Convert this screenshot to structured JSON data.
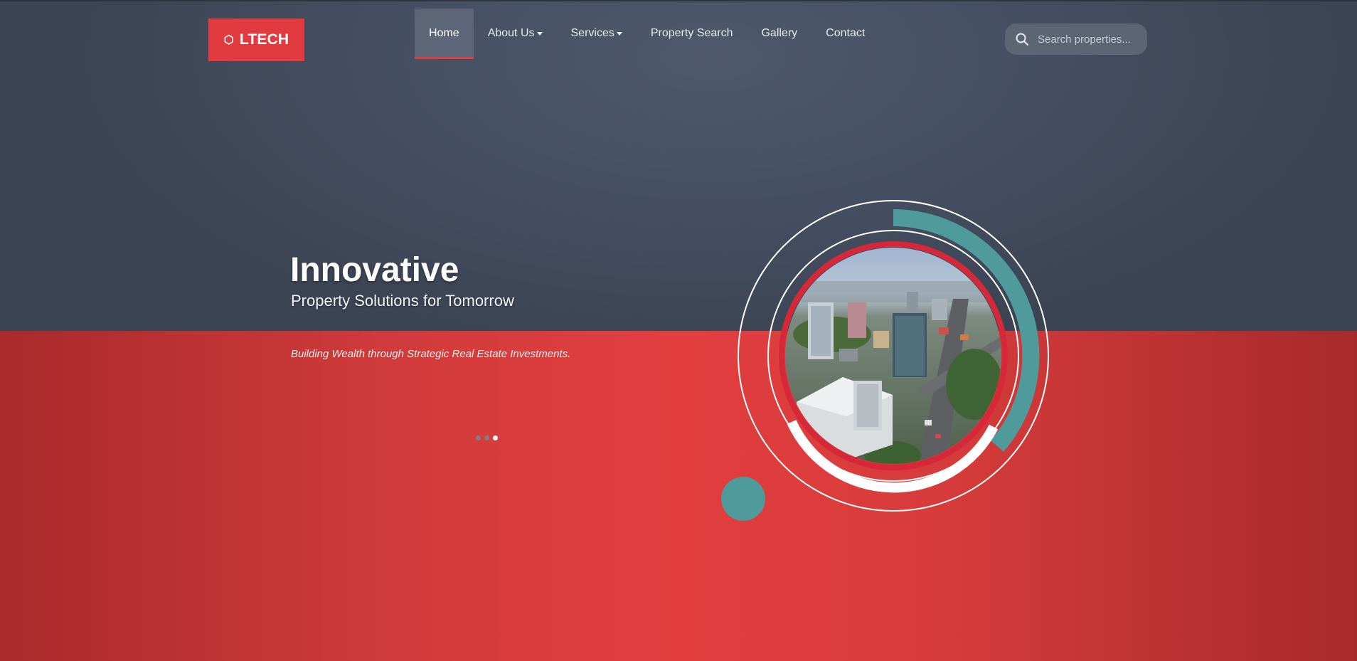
{
  "brand": {
    "logo_icon": "hexagon-icon",
    "logo_text": "LTECH",
    "accent_color": "#e23b3f",
    "teal_color": "#4f9a9a"
  },
  "nav": {
    "items": [
      {
        "label": "Home",
        "active": true,
        "dropdown": false
      },
      {
        "label": "About Us",
        "active": false,
        "dropdown": true
      },
      {
        "label": "Services",
        "active": false,
        "dropdown": true
      },
      {
        "label": "Property Search",
        "active": false,
        "dropdown": false
      },
      {
        "label": "Gallery",
        "active": false,
        "dropdown": false
      },
      {
        "label": "Contact",
        "active": false,
        "dropdown": false
      }
    ]
  },
  "search": {
    "icon": "search-icon",
    "placeholder": "Search properties...",
    "value": ""
  },
  "hero": {
    "title": "Innovative",
    "subtitle": "Property Solutions for Tomorrow",
    "tagline": "Building Wealth through Strategic Real Estate Investments.",
    "slides_count": 3,
    "active_slide": 3,
    "image": "aerial-city-photo"
  }
}
